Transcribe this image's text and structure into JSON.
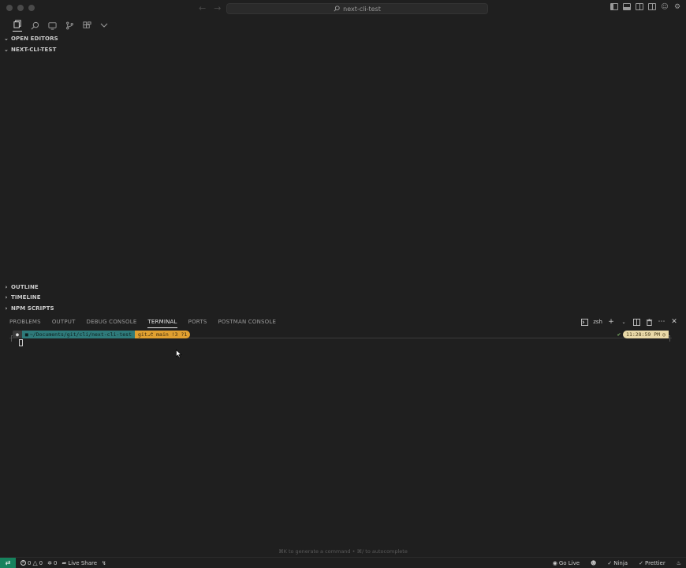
{
  "titlebar": {
    "command_center_text": "next-cli-test"
  },
  "sidebar": {
    "sections": [
      {
        "label": "OPEN EDITORS",
        "expanded": true
      },
      {
        "label": "NEXT-CLI-TEST",
        "expanded": true
      },
      {
        "label": "OUTLINE",
        "expanded": false
      },
      {
        "label": "TIMELINE",
        "expanded": false
      },
      {
        "label": "NPM SCRIPTS",
        "expanded": false
      }
    ]
  },
  "panel": {
    "tabs": [
      {
        "label": "PROBLEMS",
        "active": false
      },
      {
        "label": "OUTPUT",
        "active": false
      },
      {
        "label": "DEBUG CONSOLE",
        "active": false
      },
      {
        "label": "TERMINAL",
        "active": true
      },
      {
        "label": "PORTS",
        "active": false
      },
      {
        "label": "POSTMAN CONSOLE",
        "active": false
      }
    ],
    "shell_name": "zsh"
  },
  "terminal": {
    "path": "~/Documents/git/cli/next-cli-test",
    "git": "git⎇ main !3 ?1",
    "time": "11:28:59 PM",
    "hint": "⌘K to generate a command • ⌘/ to autocomplete"
  },
  "statusbar": {
    "errors": "0",
    "warnings": "0",
    "ports": "0",
    "live_share": "Live Share",
    "go_live": "Go Live",
    "ninja": "Ninja",
    "prettier": "Prettier"
  },
  "colors": {
    "background": "#1f1f1f",
    "remote_indicator": "#16825d",
    "path_segment": "#2e7a7a",
    "git_segment": "#e0a030",
    "time_segment": "#e9d9a8"
  }
}
